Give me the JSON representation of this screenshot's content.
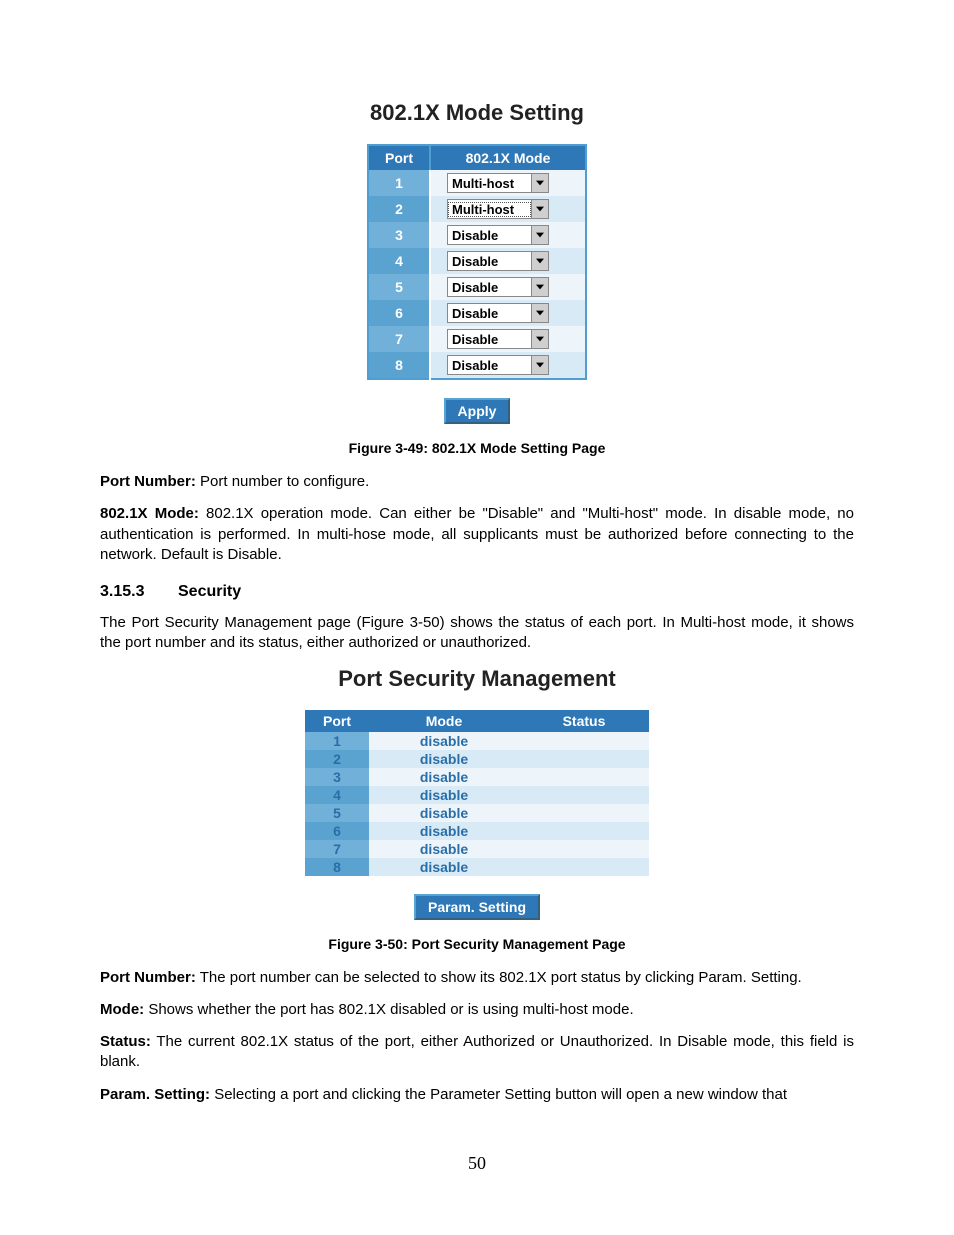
{
  "figure1": {
    "title": "802.1X Mode Setting",
    "headers": {
      "port": "Port",
      "mode": "802.1X Mode"
    },
    "rows": [
      {
        "port": "1",
        "mode": "Multi-host",
        "focused": false
      },
      {
        "port": "2",
        "mode": "Multi-host",
        "focused": true
      },
      {
        "port": "3",
        "mode": "Disable",
        "focused": false
      },
      {
        "port": "4",
        "mode": "Disable",
        "focused": false
      },
      {
        "port": "5",
        "mode": "Disable",
        "focused": false
      },
      {
        "port": "6",
        "mode": "Disable",
        "focused": false
      },
      {
        "port": "7",
        "mode": "Disable",
        "focused": false
      },
      {
        "port": "8",
        "mode": "Disable",
        "focused": false
      }
    ],
    "apply_label": "Apply",
    "caption": "Figure 3-49: 802.1X Mode Setting Page"
  },
  "defs1": {
    "port_number_label": "Port Number:",
    "port_number_text": " Port number to configure.",
    "mode_label": "802.1X Mode:",
    "mode_text": " 802.1X operation mode. Can either be \"Disable\" and \"Multi-host\" mode. In disable mode, no authentication is performed. In multi-hose mode, all supplicants must be authorized before connecting to the network. Default is Disable."
  },
  "section": {
    "number": "3.15.3",
    "title": "Security",
    "intro": "The Port Security Management page (Figure 3-50) shows the status of each port. In Multi-host mode, it shows the port number and its status, either authorized or unauthorized."
  },
  "figure2": {
    "title": "Port Security Management",
    "headers": {
      "port": "Port",
      "mode": "Mode",
      "status": "Status"
    },
    "rows": [
      {
        "port": "1",
        "mode": "disable",
        "status": ""
      },
      {
        "port": "2",
        "mode": "disable",
        "status": ""
      },
      {
        "port": "3",
        "mode": "disable",
        "status": ""
      },
      {
        "port": "4",
        "mode": "disable",
        "status": ""
      },
      {
        "port": "5",
        "mode": "disable",
        "status": ""
      },
      {
        "port": "6",
        "mode": "disable",
        "status": ""
      },
      {
        "port": "7",
        "mode": "disable",
        "status": ""
      },
      {
        "port": "8",
        "mode": "disable",
        "status": ""
      }
    ],
    "param_label": "Param. Setting",
    "caption": "Figure 3-50: Port Security Management Page"
  },
  "defs2": {
    "port_number_label": "Port Number:",
    "port_number_text": " The port number can be selected to show its 802.1X port status by clicking Param. Setting.",
    "mode_label": "Mode:",
    "mode_text": " Shows whether the port has 802.1X disabled or is using multi-host mode.",
    "status_label": "Status:",
    "status_text": " The current 802.1X status of the port, either Authorized or Unauthorized. In Disable mode, this field is blank.",
    "param_label": "Param. Setting:",
    "param_text": " Selecting a port and clicking the Parameter Setting button will open a new window that"
  },
  "page_number": "50"
}
